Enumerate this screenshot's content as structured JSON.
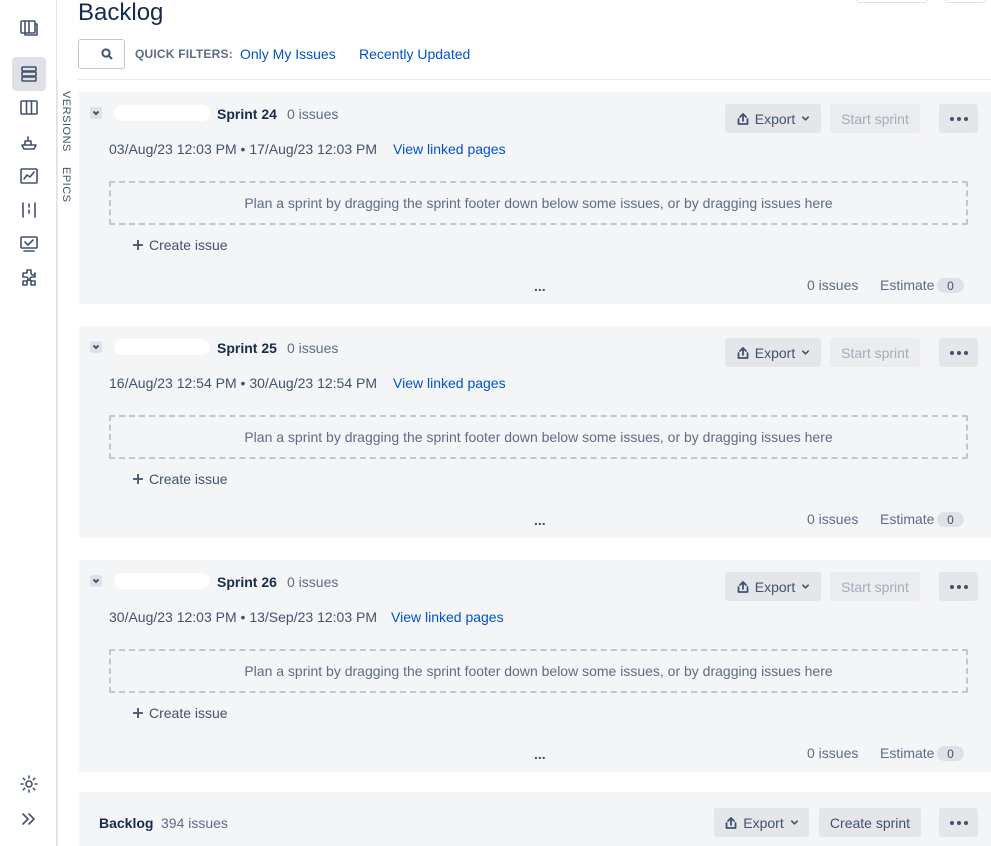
{
  "page": {
    "title": "Backlog"
  },
  "filters": {
    "label": "QUICK FILTERS:",
    "items": [
      "Only My Issues",
      "Recently Updated"
    ]
  },
  "side_tabs": [
    "VERSIONS",
    "EPICS"
  ],
  "rail_icons": [
    "board-icon",
    "backlog-icon",
    "columns-icon",
    "releases-icon",
    "reports-icon",
    "kanban-icon",
    "issues-icon",
    "addons-icon",
    "settings-icon",
    "expand-icon"
  ],
  "sprints": [
    {
      "name": "Sprint 24",
      "count": "0 issues",
      "start": "03/Aug/23 12:03 PM",
      "end": "17/Aug/23 12:03 PM",
      "linked": "View linked pages",
      "export": "Export",
      "start_sprint": "Start sprint",
      "drop_hint": "Plan a sprint by dragging the sprint footer down below some issues, or by dragging issues here",
      "create": "Create issue",
      "more": "...",
      "footer_count": "0 issues",
      "estimate_label": "Estimate",
      "estimate_value": "0"
    },
    {
      "name": "Sprint 25",
      "count": "0 issues",
      "start": "16/Aug/23 12:54 PM",
      "end": "30/Aug/23 12:54 PM",
      "linked": "View linked pages",
      "export": "Export",
      "start_sprint": "Start sprint",
      "drop_hint": "Plan a sprint by dragging the sprint footer down below some issues, or by dragging issues here",
      "create": "Create issue",
      "more": "...",
      "footer_count": "0 issues",
      "estimate_label": "Estimate",
      "estimate_value": "0"
    },
    {
      "name": "Sprint 26",
      "count": "0 issues",
      "start": "30/Aug/23 12:03 PM",
      "end": "13/Sep/23 12:03 PM",
      "linked": "View linked pages",
      "export": "Export",
      "start_sprint": "Start sprint",
      "drop_hint": "Plan a sprint by dragging the sprint footer down below some issues, or by dragging issues here",
      "create": "Create issue",
      "more": "...",
      "footer_count": "0 issues",
      "estimate_label": "Estimate",
      "estimate_value": "0"
    }
  ],
  "backlog": {
    "name": "Backlog",
    "count": "394 issues",
    "export": "Export",
    "create_sprint": "Create sprint"
  },
  "colors": {
    "link": "#0052cc",
    "panel": "#f4f5f7",
    "text": "#172b4d",
    "muted": "#5e6c84"
  }
}
